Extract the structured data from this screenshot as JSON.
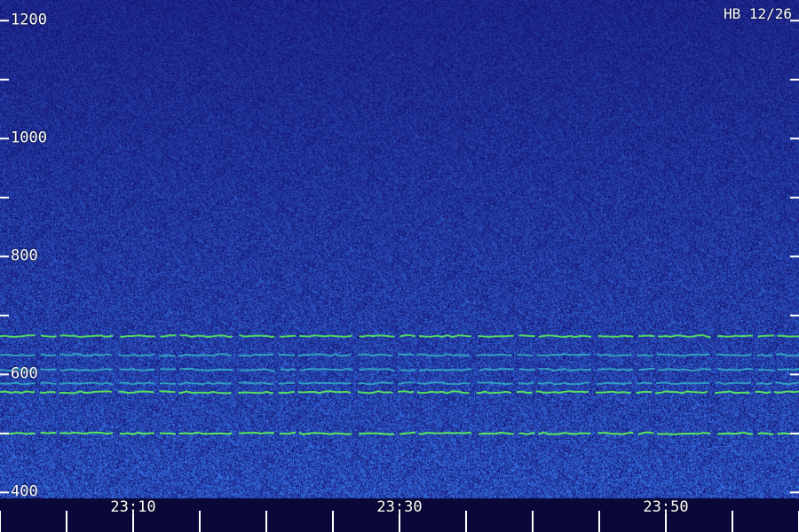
{
  "stamp": "HB 12/26",
  "chart_data": {
    "type": "heatmap",
    "title": "",
    "xlabel": "",
    "ylabel": "",
    "ylim": [
      390,
      1235
    ],
    "y_ticks": [
      400,
      500,
      600,
      700,
      800,
      900,
      1000,
      1100,
      1200
    ],
    "y_tick_labels": [
      "1200",
      "1000",
      "800",
      "600",
      "400"
    ],
    "x_ticks_minutes": [
      0,
      5,
      10,
      15,
      20,
      25,
      30,
      35,
      40,
      45,
      50,
      55,
      60
    ],
    "x_tick_labels": [
      "23:10",
      "23:30",
      "23:50"
    ],
    "x_label_minutes": [
      10,
      30,
      50
    ],
    "time_range": [
      "23:00",
      "00:00"
    ],
    "lines": [
      {
        "freq": 570,
        "intensity": 0.9
      },
      {
        "freq": 585,
        "intensity": 0.7
      },
      {
        "freq": 608,
        "intensity": 0.75
      },
      {
        "freq": 633,
        "intensity": 0.75
      },
      {
        "freq": 665,
        "intensity": 0.85
      },
      {
        "freq": 500,
        "intensity": 0.95
      }
    ],
    "colors": {
      "background": "#16107a",
      "noise_low": "#2a2cc8",
      "noise_high": "#3a78e8",
      "line_low": "#38c0c8",
      "line_high": "#5cf05a",
      "ticks": "#ffffff"
    }
  }
}
